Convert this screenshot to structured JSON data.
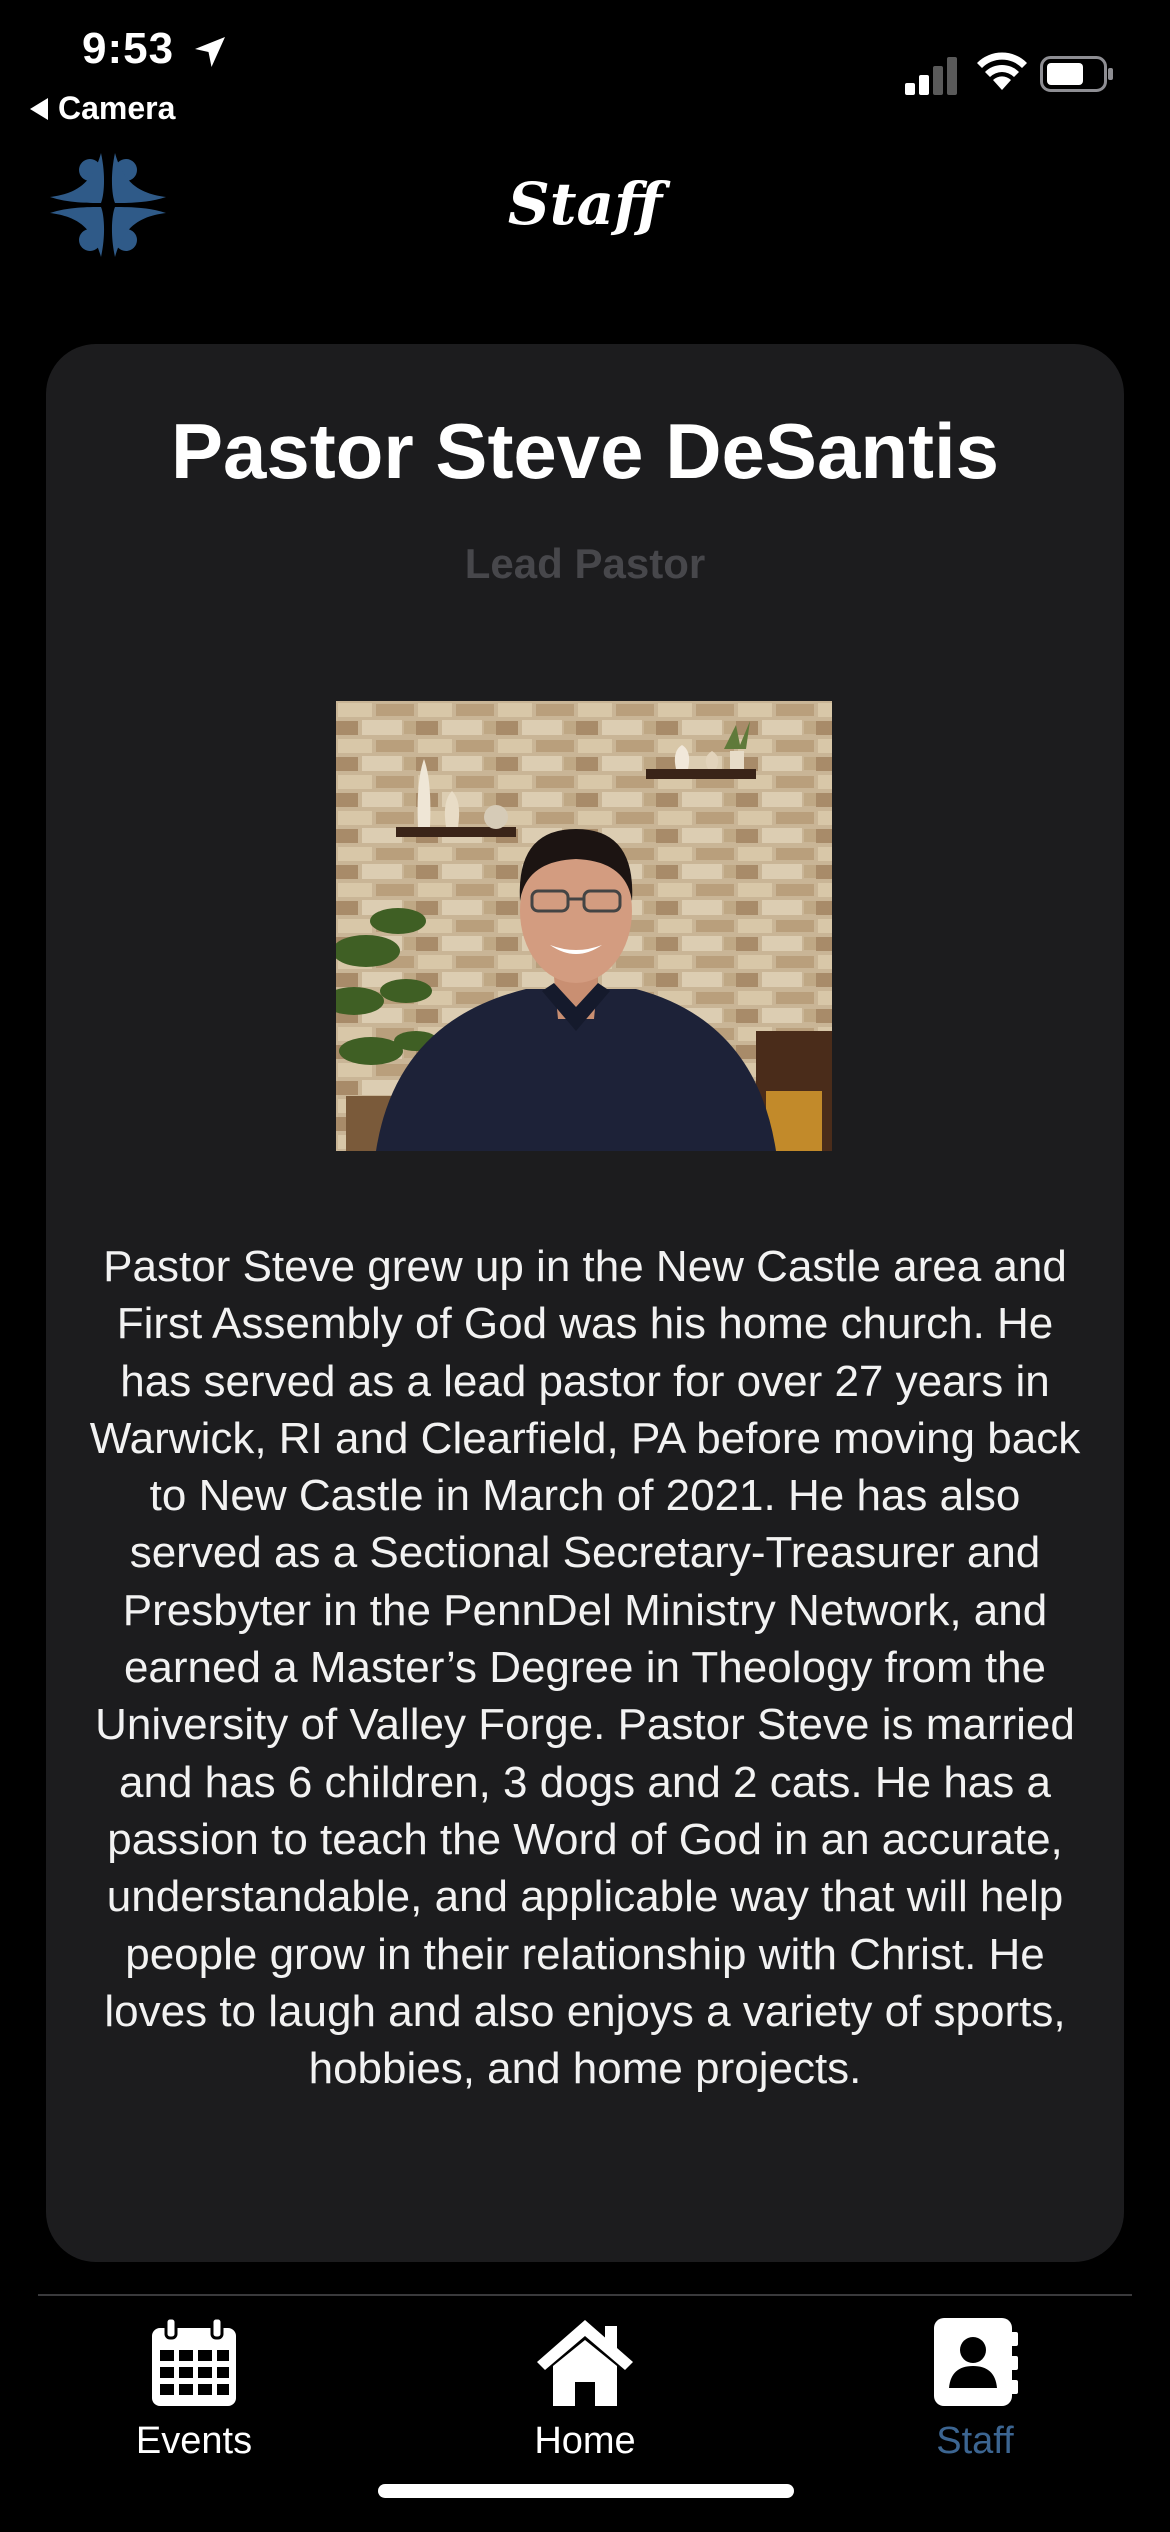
{
  "status_bar": {
    "time": "9:53",
    "back_app": "Camera"
  },
  "header": {
    "title": "Staff"
  },
  "staff": {
    "name": "Pastor Steve DeSantis",
    "role": "Lead Pastor",
    "bio": "Pastor Steve grew up in the New Castle area and First Assembly of God was his home church. He has served as a lead pastor for over 27 years in Warwick, RI and Clearfield, PA before moving back to New Castle in March of 2021. He has also served as a Sectional Secretary-Treasurer and Presbyter in the PennDel Ministry Network, and earned a Master’s Degree in Theology from the University of Valley Forge. Pastor Steve is married and has 6 children, 3 dogs and 2 cats. He has a passion to teach the Word of God in an accurate, understandable, and applicable way that will help people grow in their relationship with Christ. He loves to laugh and also enjoys a variety of sports, hobbies, and home projects."
  },
  "tab_bar": {
    "tabs": [
      {
        "label": "Events",
        "icon": "calendar-icon",
        "active": false
      },
      {
        "label": "Home",
        "icon": "home-icon",
        "active": false
      },
      {
        "label": "Staff",
        "icon": "contact-book-icon",
        "active": true
      }
    ],
    "active_color": "#3c6591",
    "inactive_color": "#ffffff"
  },
  "colors": {
    "background": "#000000",
    "card": "#1c1c1e",
    "logo_blue": "#2f5a88",
    "role_text": "#47474b"
  }
}
